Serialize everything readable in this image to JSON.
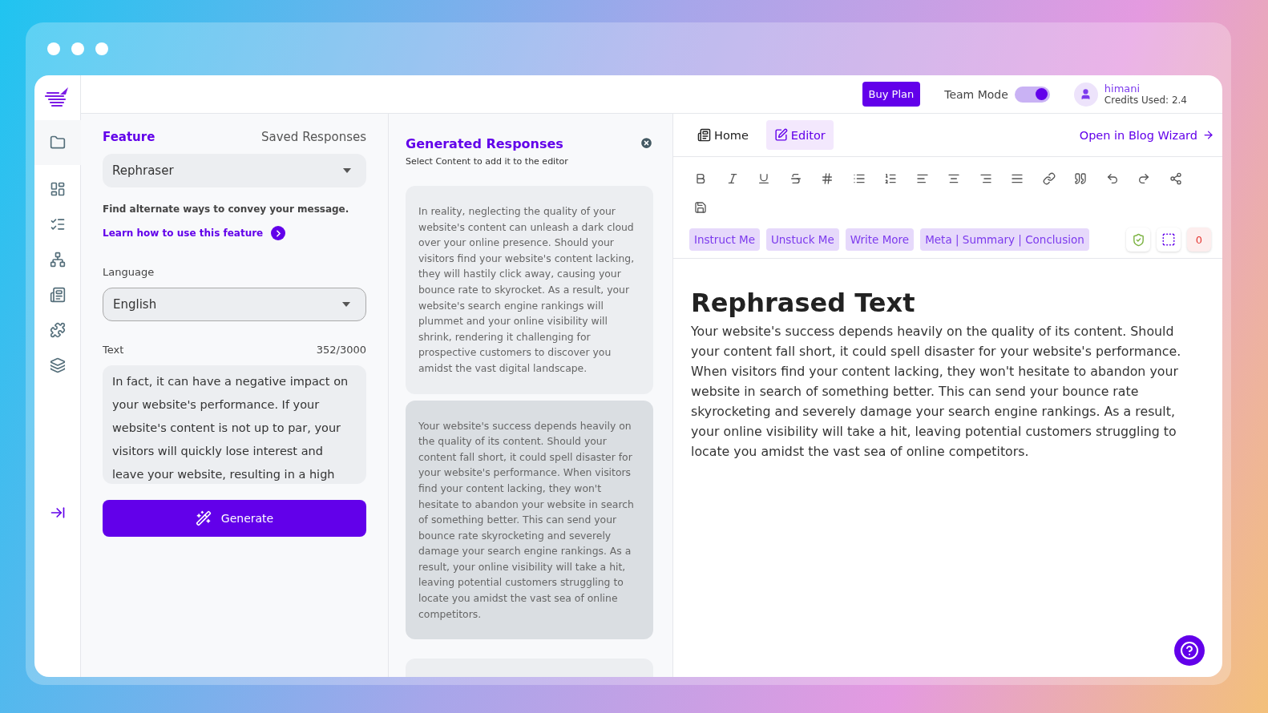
{
  "sidebar": {
    "items": [
      {
        "kind": "folder",
        "selected": true
      },
      {
        "kind": "dashboard",
        "selected": false
      },
      {
        "kind": "checklist",
        "selected": false
      },
      {
        "kind": "sitemap",
        "selected": false
      },
      {
        "kind": "article",
        "selected": false
      },
      {
        "kind": "puzzle",
        "selected": false
      },
      {
        "kind": "layers",
        "selected": false
      }
    ]
  },
  "header": {
    "buy_button": "Buy Plan",
    "team_mode": {
      "label": "Team Mode",
      "on": true
    },
    "user": {
      "name": "himani",
      "credits": "Credits Used: 2.4"
    }
  },
  "feature_panel": {
    "tabs": [
      {
        "label": "Feature",
        "selected": true
      },
      {
        "label": "Saved Responses",
        "selected": false
      }
    ],
    "feature_select": "Rephraser",
    "description": "Find alternate ways to convey your message.",
    "learn_link": "Learn how to use this feature",
    "language_label": "Language",
    "language_select": "English",
    "text_label": "Text",
    "text_count": "352/3000",
    "text_value": "In fact, it can have a negative impact on your website's performance. If your website's content is not up to par, your visitors will quickly lose interest and leave your website, resulting in a high",
    "generate_button": "Generate"
  },
  "responses": {
    "title": "Generated Responses",
    "subtitle": "Select Content to add it to the editor",
    "cards": [
      {
        "text": "In reality, neglecting the quality of your website's content can unleash a dark cloud over your online presence. Should your visitors find your website's content lacking, they will hastily click away, causing your bounce rate to skyrocket. As a result, your website's search engine rankings will plummet and your online visibility will shrink, rendering it challenging for prospective customers to discover you amidst the vast digital landscape.",
        "selected": false
      },
      {
        "text": "Your website's success depends heavily on the quality of its content. Should your content fall short, it could spell disaster for your website's performance. When visitors find your content lacking, they won't hesitate to abandon your website in search of something better. This can send your bounce rate skyrocketing and severely damage your search engine rankings. As a result, your online visibility will take a hit, leaving potential customers struggling to locate you amidst the vast sea of online competitors.",
        "selected": true
      },
      {
        "selected": false
      }
    ]
  },
  "editor": {
    "tabs": [
      {
        "label": "Home",
        "kind": "home",
        "selected": false
      },
      {
        "label": "Editor",
        "kind": "editor",
        "selected": true
      }
    ],
    "open_link": "Open in Blog Wizard",
    "toolbar": [
      {
        "kind": "bold"
      },
      {
        "kind": "italic"
      },
      {
        "kind": "underline"
      },
      {
        "kind": "strike"
      },
      {
        "kind": "heading"
      },
      {
        "kind": "bullets"
      },
      {
        "kind": "numbers"
      },
      {
        "kind": "left"
      },
      {
        "kind": "center"
      },
      {
        "kind": "right"
      },
      {
        "kind": "justify"
      },
      {
        "kind": "link"
      },
      {
        "kind": "quote"
      },
      {
        "kind": "undo"
      },
      {
        "kind": "redo"
      },
      {
        "kind": "share"
      },
      {
        "kind": "save"
      }
    ],
    "chips": [
      "Instruct Me",
      "Unstuck Me",
      "Write More",
      "Meta | Summary | Conclusion"
    ],
    "counter": "0",
    "heading": "Rephrased Text",
    "body": "Your website's success depends heavily on the quality of its content. Should your content fall short, it could spell disaster for your website's performance. When visitors find your content lacking, they won't hesitate to abandon your website in search of something better. This can send your bounce rate skyrocketing and severely damage your search engine rankings. As a result, your online visibility will take a hit, leaving potential customers struggling to locate you amidst the vast sea of online competitors."
  }
}
